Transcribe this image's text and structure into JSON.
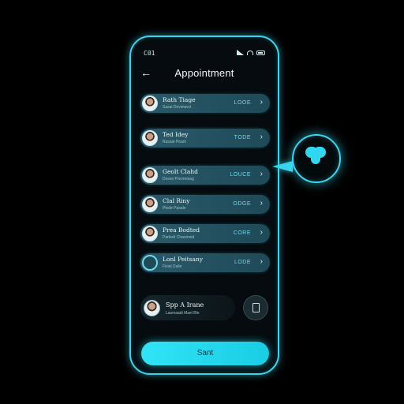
{
  "status_bar": {
    "time": "C01"
  },
  "header": {
    "title": "Appointment"
  },
  "appointments": [
    {
      "name": "Rath Tiage",
      "sub": "Sasai Deviewed",
      "code": "LOOE"
    },
    {
      "name": "Ted Idey",
      "sub": "Rasaie Peam",
      "code": "TODE"
    },
    {
      "name": "Geolt Clahd",
      "sub": "Dosse Prevreoiag",
      "code": "LOUCE"
    },
    {
      "name": "Clal Riny",
      "sub": "Plede Pasale",
      "code": "ODGE"
    },
    {
      "name": "Prea Bodted",
      "sub": "Padvell Chasmoid",
      "code": "CORE"
    },
    {
      "name": "Lonl Peitsany",
      "sub": "Fisial Dalie",
      "code": "LODE"
    }
  ],
  "summary_card": {
    "name": "Spp A Irane",
    "sub": "Lasmaadi Mael Ble"
  },
  "start_button": {
    "label": "Sant"
  },
  "accent": "#38d6ee",
  "button_color": "#31e3f6",
  "bubble_icon": "heart-plus-icon"
}
